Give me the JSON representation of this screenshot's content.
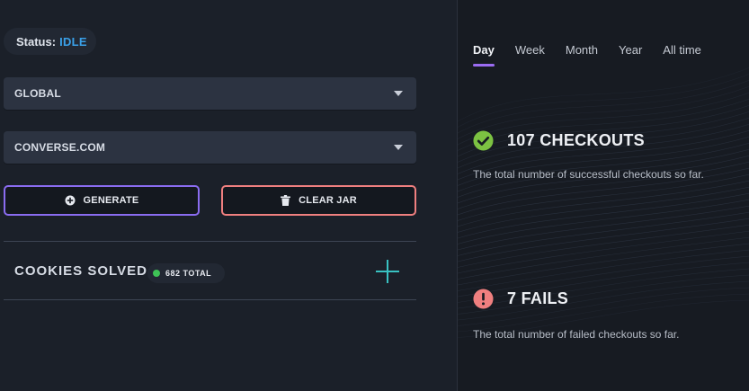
{
  "status": {
    "label": "Status:",
    "value": "IDLE"
  },
  "selects": {
    "scope": {
      "value": "GLOBAL"
    },
    "site": {
      "value": "CONVERSE.COM"
    }
  },
  "buttons": {
    "generate": {
      "label": "GENERATE",
      "icon": "plus-circle-icon"
    },
    "clear_jar": {
      "label": "CLEAR JAR",
      "icon": "trash-icon"
    }
  },
  "cookies": {
    "title": "COOKIES SOLVED",
    "total_label": "682 TOTAL",
    "add_icon": "plus-icon"
  },
  "tabs": [
    {
      "label": "Day",
      "active": true
    },
    {
      "label": "Week",
      "active": false
    },
    {
      "label": "Month",
      "active": false
    },
    {
      "label": "Year",
      "active": false
    },
    {
      "label": "All time",
      "active": false
    }
  ],
  "stats": {
    "checkouts": {
      "title": "107 CHECKOUTS",
      "description": "The total number of successful checkouts so far.",
      "icon": "check-circle-icon"
    },
    "fails": {
      "title": "7 FAILS",
      "description": "The total number of failed checkouts so far.",
      "icon": "alert-circle-icon"
    }
  },
  "colors": {
    "background": "#1b2029",
    "accent_purple": "#9b6cf2",
    "status_blue": "#3aa0e8",
    "danger": "#ef7f7f",
    "success": "#7cc242",
    "plus_teal": "#39c2c2"
  }
}
